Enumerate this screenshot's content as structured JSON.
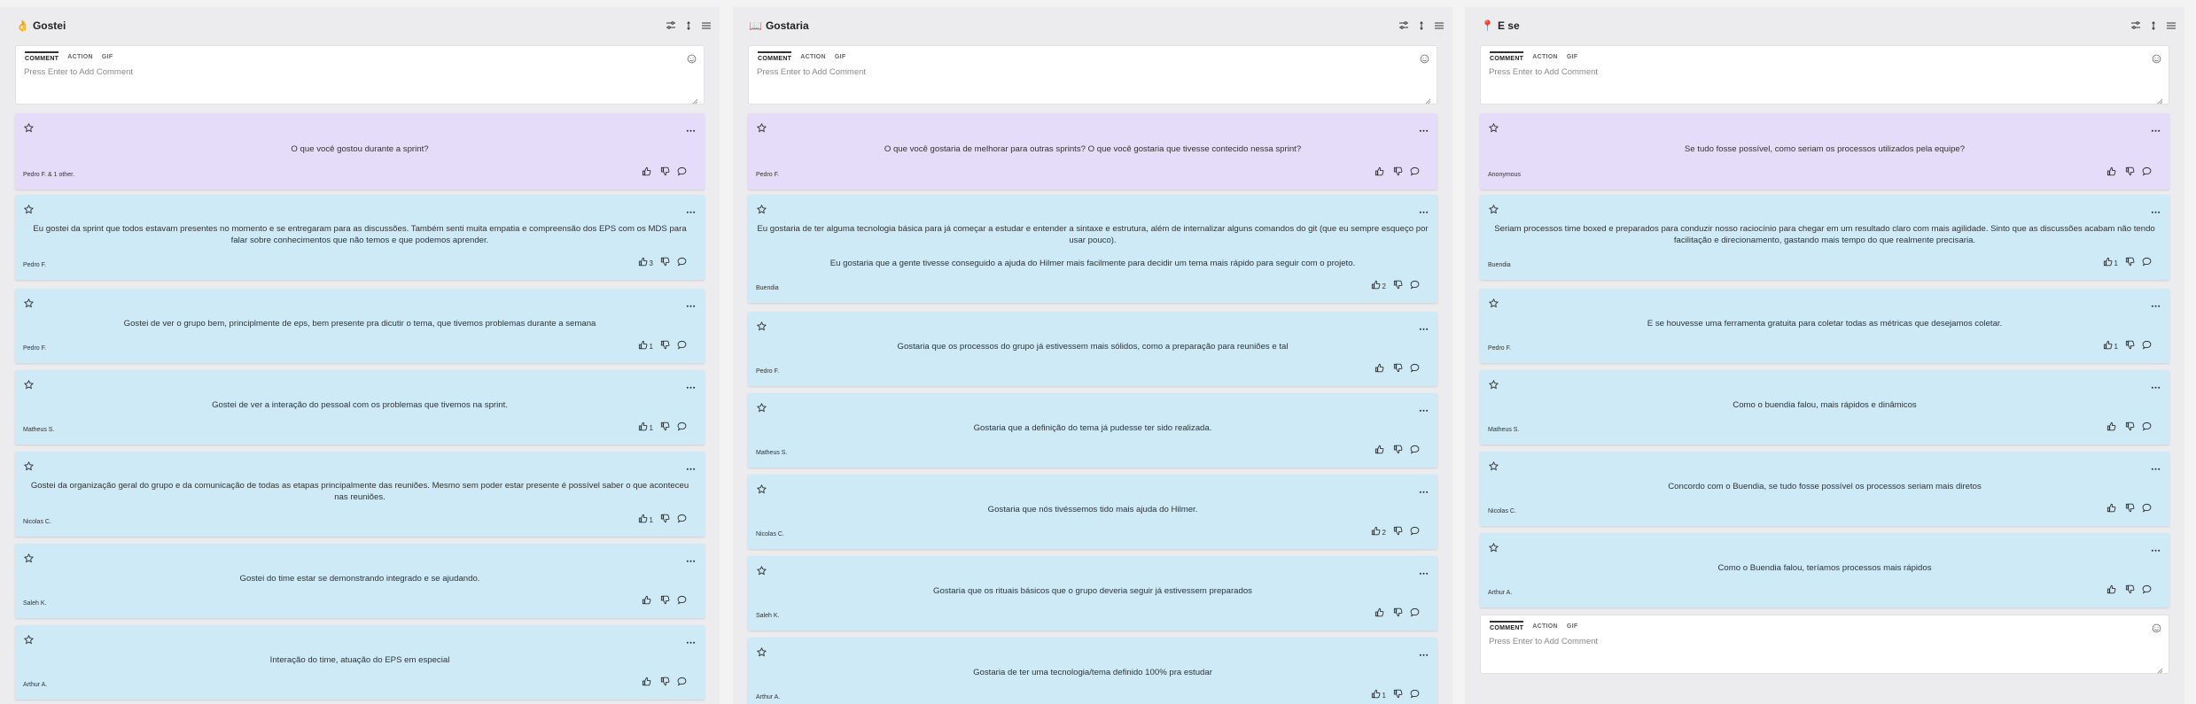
{
  "columns": [
    {
      "emoji": "👌",
      "title": "Gostei",
      "comment_box": {
        "tabs": [
          "COMMENT",
          "ACTION",
          "GIF"
        ],
        "placeholder": "Press Enter to Add Comment"
      },
      "cards": [
        {
          "variant": "prompt",
          "text": "O que você gostou durante a sprint?",
          "author": "Pedro F. & 1 other.",
          "likes": ""
        },
        {
          "variant": "normal",
          "text": "Eu gostei da sprint que todos estavam presentes no momento e se entregaram para as discussões. Também senti muita empatia e compreensão dos EPS com os MDS para falar sobre conhecimentos que não temos e que podemos aprender.",
          "author": "Pedro F.",
          "likes": "3"
        },
        {
          "variant": "normal",
          "text": "Gostei de ver o grupo bem, principlmente de eps, bem presente pra dicutir o tema, que tivemos problemas durante a semana",
          "author": "Pedro F.",
          "likes": "1"
        },
        {
          "variant": "normal",
          "text": "Gostei de ver a interação do pessoal com os problemas que tivemos na sprint.",
          "author": "Matheus S.",
          "likes": "1"
        },
        {
          "variant": "normal",
          "text": "Gostei da organização geral do grupo e da comunicação de todas as etapas principalmente das reuniões. Mesmo sem poder estar presente é possível saber o que aconteceu nas reuniões.",
          "author": "Nicolas C.",
          "likes": "1"
        },
        {
          "variant": "normal",
          "text": "Gostei do time estar se demonstrando integrado e se ajudando.",
          "author": "Saleh K.",
          "likes": ""
        },
        {
          "variant": "normal",
          "text": "Interação do time, atuação do EPS em especial",
          "author": "Arthur A.",
          "likes": ""
        }
      ]
    },
    {
      "emoji": "📖",
      "title": "Gostaria",
      "comment_box": {
        "tabs": [
          "COMMENT",
          "ACTION",
          "GIF"
        ],
        "placeholder": "Press Enter to Add Comment"
      },
      "cards": [
        {
          "variant": "prompt",
          "text": "O que você gostaria de melhorar para outras sprints? O que você gostaria que tivesse contecido nessa sprint?",
          "author": "Pedro F.",
          "likes": ""
        },
        {
          "variant": "normal",
          "text": "Eu gostaria de ter alguma tecnologia básica para já começar a estudar e entender a sintaxe e estrutura, além de internalizar alguns comandos do git (que eu sempre esqueço por usar pouco).\n\nEu gostaria que a gente tivesse conseguido a ajuda do Hilmer mais facilmente para decidir um tema mais rápido para seguir com o projeto.",
          "author": "Buendia",
          "likes": "2"
        },
        {
          "variant": "normal",
          "text": "Gostaria que os processos do grupo já estivessem mais sólidos, como a preparação para reuniões e tal",
          "author": "Pedro F.",
          "likes": ""
        },
        {
          "variant": "normal",
          "text": "Gostaria que a definição do tema já pudesse ter sido realizada.",
          "author": "Matheus S.",
          "likes": ""
        },
        {
          "variant": "normal",
          "text": "Gostaria que nós tivéssemos tido mais ajuda do Hilmer.",
          "author": "Nicolas C.",
          "likes": "2"
        },
        {
          "variant": "normal",
          "text": "Gostaria que os rituais básicos que o grupo deveria seguir já estivessem preparados",
          "author": "Saleh K.",
          "likes": ""
        },
        {
          "variant": "normal",
          "text": "Gostaria de ter uma tecnologia/tema definido 100% pra estudar",
          "author": "Arthur A.",
          "likes": "1"
        }
      ]
    },
    {
      "emoji": "📍",
      "title": "E se",
      "comment_box": {
        "tabs": [
          "COMMENT",
          "ACTION",
          "GIF"
        ],
        "placeholder": "Press Enter to Add Comment"
      },
      "cards": [
        {
          "variant": "prompt",
          "text": "Se tudo fosse possível, como seriam os processos utilizados pela equipe?",
          "author": "Anonymous",
          "likes": ""
        },
        {
          "variant": "normal",
          "text": "Seriam processos time boxed e preparados para conduzir nosso raciocínio para chegar em um resultado claro com mais agilidade. Sinto que as discussões acabam não tendo facilitação e direcionamento, gastando mais tempo do que realmente precisaria.",
          "author": "Buendia",
          "likes": "1"
        },
        {
          "variant": "normal",
          "text": "E se houvesse uma ferramenta gratuita para coletar todas as métricas que desejamos coletar.",
          "author": "Pedro F.",
          "likes": "1"
        },
        {
          "variant": "normal",
          "text": "Como o buendia falou, mais rápidos e dinâmicos",
          "author": "Matheus S.",
          "likes": ""
        },
        {
          "variant": "normal",
          "text": "Concordo com o Buendia, se tudo fosse possível os processos seriam mais diretos",
          "author": "Nicolas C.",
          "likes": ""
        },
        {
          "variant": "normal",
          "text": "Como o Buendia falou, teríamos processos mais rápidos",
          "author": "Arthur A.",
          "likes": ""
        }
      ],
      "bottom_comment_box": {
        "tabs": [
          "COMMENT",
          "ACTION",
          "GIF"
        ],
        "placeholder": "Press Enter to Add Comment"
      }
    }
  ]
}
